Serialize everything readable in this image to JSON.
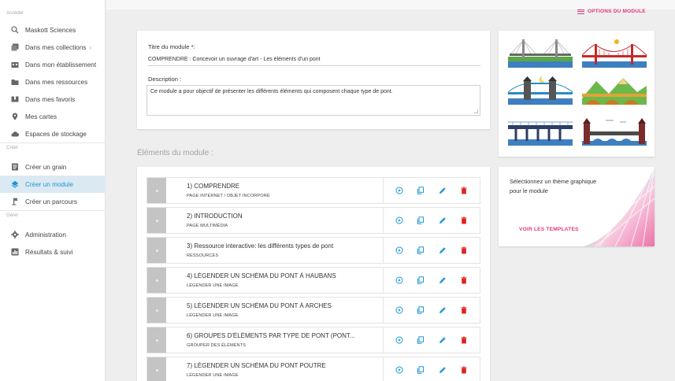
{
  "sidebar": {
    "sections": [
      "Accéder",
      "Créer",
      "Gérer"
    ],
    "items": [
      {
        "label": "Maskott Sciences",
        "icon": "search-icon"
      },
      {
        "label": "Dans mes collections",
        "icon": "collection-icon"
      },
      {
        "label": "Dans mon établissement",
        "icon": "school-icon"
      },
      {
        "label": "Dans mes ressources",
        "icon": "folder-icon"
      },
      {
        "label": "Dans mes favoris",
        "icon": "bookmark-icon"
      },
      {
        "label": "Mes cartes",
        "icon": "map-pin-icon"
      },
      {
        "label": "Espaces de stockage",
        "icon": "cloud-icon"
      },
      {
        "label": "Créer un grain",
        "icon": "grain-icon"
      },
      {
        "label": "Créer un module",
        "icon": "module-icon"
      },
      {
        "label": "Créer un parcours",
        "icon": "path-icon"
      },
      {
        "label": "Administration",
        "icon": "gear-icon"
      },
      {
        "label": "Résultats & suivi",
        "icon": "chart-icon"
      }
    ],
    "collections_chevron": "›"
  },
  "header": {
    "options_label": "OPTIONS DU MODULE"
  },
  "form": {
    "title_label": "Titre du module *:",
    "title_value": "COMPRENDRE : Concevoir un ouvrage d'art - Les éléments d'un pont",
    "description_label": "Description :",
    "description_value": "Ce module a pour objectif de présenter les différents éléments qui composent chaque type de pont."
  },
  "elements": {
    "heading": "Éléments du module :",
    "rows": [
      {
        "title": "1) COMPRENDRE",
        "type": "PAGE INTERNET / OBJET INCORPORÉ"
      },
      {
        "title": "2) INTRODUCTION",
        "type": "PAGE MULTIMÉDIA"
      },
      {
        "title": "3) Ressource interactive: les différents types de pont",
        "type": "RESSOURCES"
      },
      {
        "title": "4) LÉGENDER UN SCHÉMA DU PONT À HAUBANS",
        "type": "LÉGENDER UNE IMAGE"
      },
      {
        "title": "5) LÉGENDER UN SCHÉMA DU PONT À ARCHES",
        "type": "LÉGENDER UNE IMAGE"
      },
      {
        "title": "6) GROUPES D'ÉLÉMENTS PAR TYPE DE PONT (PONT...",
        "type": "GROUPER DES ÉLÉMENTS"
      },
      {
        "title": "7) LÉGENDER UN SCHÉMA DU PONT POUTRE",
        "type": "LÉGENDER UNE IMAGE"
      }
    ]
  },
  "theme": {
    "text": "Sélectionnez un thème graphique pour le module",
    "button": "VOIR LES TEMPLATES"
  },
  "colors": {
    "accent_pink": "#e03a7f",
    "accent_blue": "#1f97d4",
    "active_bg": "#dbe9f3",
    "delete_red": "#e02020"
  }
}
